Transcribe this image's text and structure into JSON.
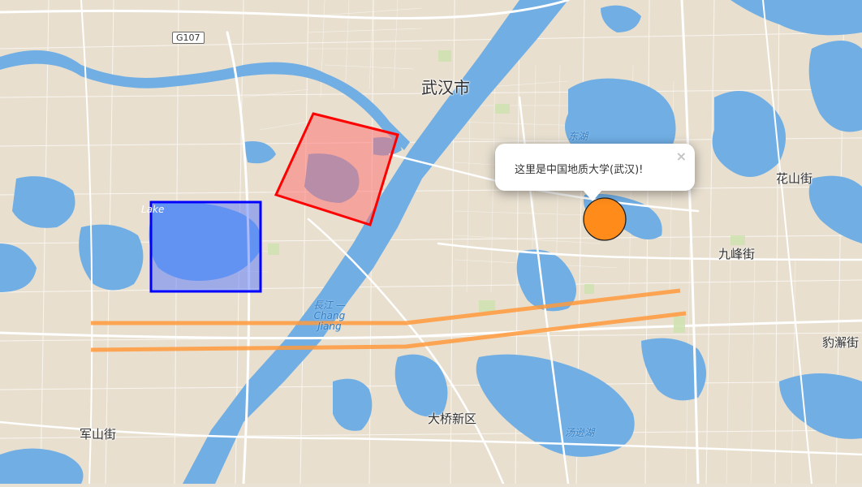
{
  "map": {
    "city_label": "武汉市",
    "district_labels": [
      {
        "name": "花山街"
      },
      {
        "name": "九峰街"
      },
      {
        "name": "豹澥街"
      },
      {
        "name": "大桥新区"
      },
      {
        "name": "军山街"
      }
    ],
    "water_labels": {
      "river": "長江 —\nChang\nJiang",
      "lake_east": "东湖",
      "lake_south": "汤逊湖",
      "lake_west": "Lake"
    },
    "road_shield": "G107",
    "popup": {
      "text": "这里是中国地质大学(武汉)!",
      "close": "×"
    },
    "overlays": {
      "rectangle_blue": {
        "stroke": "#0000ff",
        "fill": "#5577ff"
      },
      "polygon_red": {
        "stroke": "#ff0000",
        "fill": "#ff6b6b"
      },
      "circle": {
        "stroke": "#222222",
        "fill": "#ff8c1a"
      },
      "polyline": {
        "stroke": "#ff9a3c"
      }
    }
  }
}
